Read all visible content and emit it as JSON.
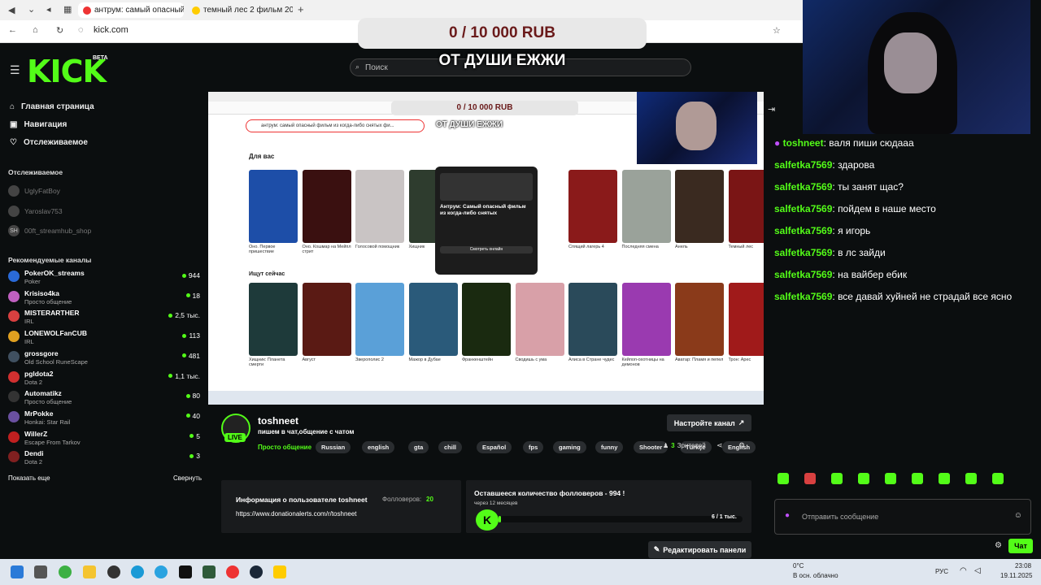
{
  "browser": {
    "tabs": [
      {
        "label": "антрум: самый опасный"
      },
      {
        "label": "темный лес 2 фильм 201"
      }
    ],
    "url": "kick.com"
  },
  "overlay": {
    "donation": "0 / 10 000 RUB",
    "title": "ОТ ДУШИ ЕЖЖИ"
  },
  "header": {
    "logo": "KICK",
    "beta": "BETA",
    "search_placeholder": "Поиск"
  },
  "sidebar": {
    "nav": [
      {
        "label": "Главная страница"
      },
      {
        "label": "Навигация"
      },
      {
        "label": "Отслеживаемое"
      }
    ],
    "followed_header": "Отслеживаемое",
    "followed": [
      {
        "name": "UglyFatBoy"
      },
      {
        "name": "Yaroslav753"
      },
      {
        "name": "00ft_streamhub_shop"
      }
    ],
    "recommended_header": "Рекомендуемые каналы",
    "recommended": [
      {
        "name": "PokerOK_streams",
        "category": "Poker",
        "viewers": "944"
      },
      {
        "name": "Krisiso4ka",
        "category": "Просто общение",
        "viewers": "18"
      },
      {
        "name": "MISTERARTHER",
        "category": "IRL",
        "viewers": "2,5 тыс."
      },
      {
        "name": "LONEWOLFanCUB",
        "category": "IRL",
        "viewers": "113"
      },
      {
        "name": "grossgore",
        "category": "Old School RuneScape",
        "viewers": "481"
      },
      {
        "name": "pgldota2",
        "category": "Dota 2",
        "viewers": "1,1 тыс."
      },
      {
        "name": "Automatikz",
        "category": "Просто общение",
        "viewers": "80"
      },
      {
        "name": "MrPokke",
        "category": "Honkai: Star Rail",
        "viewers": "40"
      },
      {
        "name": "WillerZ",
        "category": "Escape From Tarkov",
        "viewers": "5"
      },
      {
        "name": "Dendi",
        "category": "Dota 2",
        "viewers": "3"
      }
    ],
    "show_more": "Показать еще",
    "collapse": "Свернуть"
  },
  "stream_capture": {
    "donation": "0 / 10 000 RUB",
    "title": "ОТ ДУШИ ЕЖЖИ",
    "search_text": "антрум: самый опасный фильм из когда-либо снятых фи...",
    "for_you": "Для вас",
    "watching_now": "Ищут сейчас",
    "popup_title": "Антрум: Самый опасный фильм из когда-либо снятых",
    "popup_button": "Смотреть онлайн",
    "row1": [
      {
        "title": "Оно. Первое пришествие",
        "color": "#1d4ea8"
      },
      {
        "title": "Оно. Кошмар на Мейпл стрит",
        "color": "#3a1010"
      },
      {
        "title": "Голосовой помощник",
        "color": "#c9c4c4"
      },
      {
        "title": "Хищник",
        "color": "#2e3c2e"
      },
      {
        "title": "Спящий лагерь 4",
        "color": "#8a1a1a"
      },
      {
        "title": "Последняя смена",
        "color": "#9aa29a"
      },
      {
        "title": "Анель",
        "color": "#3a2a20"
      },
      {
        "title": "Темный лес",
        "color": "#7a1515"
      }
    ],
    "row2": [
      {
        "title": "Хищник: Планета смерти",
        "color": "#1e3a3a"
      },
      {
        "title": "Август",
        "color": "#5a1a14"
      },
      {
        "title": "Зверополис 2",
        "color": "#5aa0d8"
      },
      {
        "title": "Мажор в Дубае",
        "color": "#2a5a7a"
      },
      {
        "title": "Франкенштейн",
        "color": "#1a2a10"
      },
      {
        "title": "Сводишь с ума",
        "color": "#d8a0a8"
      },
      {
        "title": "Алиса в Стране чудес",
        "color": "#2a4a5a"
      },
      {
        "title": "Кейпоп-охотницы на демонов",
        "color": "#9a3ab0"
      },
      {
        "title": "Аватар: Пламя и пепел",
        "color": "#8a3a1a"
      },
      {
        "title": "Трон: Арес",
        "color": "#a01a1a"
      }
    ]
  },
  "chat": {
    "messages": [
      {
        "user": "toshneet",
        "text": "валя пиши сюдааа"
      },
      {
        "user": "salfetka7569",
        "text": "здарова"
      },
      {
        "user": "salfetka7569",
        "text": "ты занят щас?"
      },
      {
        "user": "salfetka7569",
        "text": "пойдем в наше место"
      },
      {
        "user": "salfetka7569",
        "text": "я игорь"
      },
      {
        "user": "salfetka7569",
        "text": "в лс зайди"
      },
      {
        "user": "salfetka7569",
        "text": "на вайбер ебик"
      },
      {
        "user": "salfetka7569",
        "text": "все давай хуйней не страдай все ясно"
      }
    ],
    "input_placeholder": "Отправить сообщение",
    "send_label": "Чат"
  },
  "channel": {
    "name": "toshneet",
    "live": "LIVE",
    "title": "пишем в чат,общение с чатом",
    "category": "Просто общение",
    "tags": [
      "Russian",
      "english",
      "gta",
      "chill",
      "Español",
      "fps",
      "gaming",
      "funny",
      "Shooter",
      "Türkçe",
      "English"
    ],
    "setup_button": "Настройте канал",
    "viewers_count": "3",
    "viewers_label": "Зрителей",
    "info_title": "Информация о пользователе toshneet",
    "followers_label": "Фолловеров:",
    "followers_count": "20",
    "link": "https://www.donationalerts.com/r/toshneet",
    "goal_title": "Оставшееся количество фолловеров - 994 !",
    "goal_sub": "через 12 месяцев",
    "goal_progress": "6 / 1 тыс.",
    "goal_fraction": 0.006,
    "edit_panels": "Редактировать панели"
  },
  "taskbar": {
    "weather_temp": "0°С",
    "weather_desc": "В осн. облачно",
    "lang": "РУС",
    "time": "23:08",
    "date": "19.11.2025"
  },
  "colors": {
    "brand": "#53fc18",
    "background": "#0b0e0f"
  }
}
